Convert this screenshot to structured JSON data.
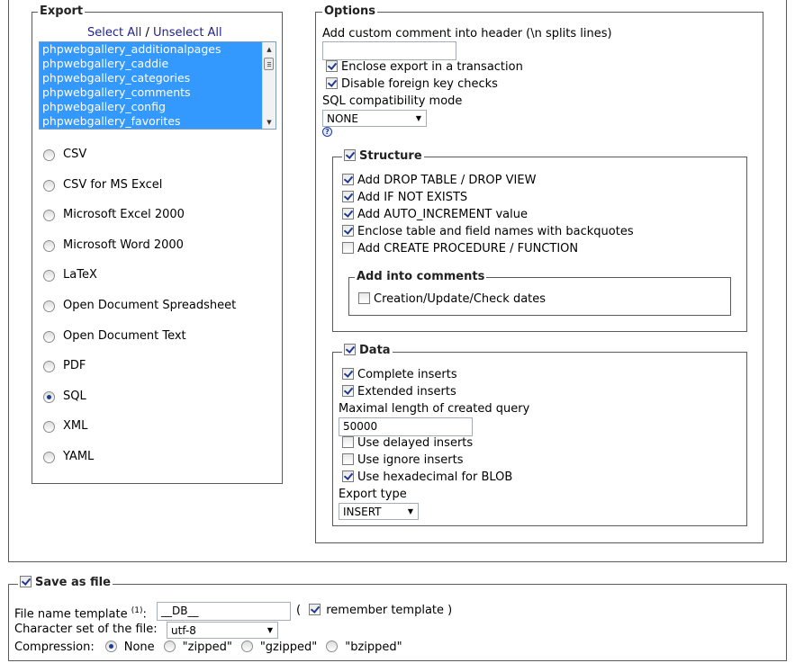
{
  "export": {
    "legend": "Export",
    "select_all": "Select All",
    "separator": "/",
    "unselect_all": "Unselect All",
    "tables": [
      "phpwebgallery_additionalpages",
      "phpwebgallery_caddie",
      "phpwebgallery_categories",
      "phpwebgallery_comments",
      "phpwebgallery_config",
      "phpwebgallery_favorites"
    ],
    "formats": [
      {
        "label": "CSV",
        "selected": false
      },
      {
        "label": "CSV for MS Excel",
        "selected": false
      },
      {
        "label": "Microsoft Excel 2000",
        "selected": false
      },
      {
        "label": "Microsoft Word 2000",
        "selected": false
      },
      {
        "label": "LaTeX",
        "selected": false
      },
      {
        "label": "Open Document Spreadsheet",
        "selected": false
      },
      {
        "label": "Open Document Text",
        "selected": false
      },
      {
        "label": "PDF",
        "selected": false
      },
      {
        "label": "SQL",
        "selected": true
      },
      {
        "label": "XML",
        "selected": false
      },
      {
        "label": "YAML",
        "selected": false
      }
    ]
  },
  "options": {
    "legend": "Options",
    "comment_label": "Add custom comment into header (\\n splits lines)",
    "comment_value": "",
    "transaction": {
      "label": "Enclose export in a transaction",
      "checked": true
    },
    "foreign_keys": {
      "label": "Disable foreign key checks",
      "checked": true
    },
    "compat_label": "SQL compatibility mode",
    "compat_value": "NONE",
    "help_glyph": "?"
  },
  "structure": {
    "legend": "Structure",
    "checked": true,
    "items": [
      {
        "label": "Add DROP TABLE / DROP VIEW",
        "checked": true
      },
      {
        "label": "Add IF NOT EXISTS",
        "checked": true
      },
      {
        "label": "Add AUTO_INCREMENT value",
        "checked": true
      },
      {
        "label": "Enclose table and field names with backquotes",
        "checked": true
      },
      {
        "label": "Add CREATE PROCEDURE / FUNCTION",
        "checked": false
      }
    ],
    "comments_legend": "Add into comments",
    "comments_dates": {
      "label": "Creation/Update/Check dates",
      "checked": false
    }
  },
  "data_section": {
    "legend": "Data",
    "checked": true,
    "complete_inserts": {
      "label": "Complete inserts",
      "checked": true
    },
    "extended_inserts": {
      "label": "Extended inserts",
      "checked": true
    },
    "max_length_label": "Maximal length of created query",
    "max_length_value": "50000",
    "delayed_inserts": {
      "label": "Use delayed inserts",
      "checked": false
    },
    "ignore_inserts": {
      "label": "Use ignore inserts",
      "checked": false
    },
    "hex_blob": {
      "label": "Use hexadecimal for BLOB",
      "checked": true
    },
    "export_type_label": "Export type",
    "export_type_value": "INSERT"
  },
  "save": {
    "legend": "Save as file",
    "checked": true,
    "filename_label": "File name template",
    "filename_sup": "(1)",
    "filename_colon": ":",
    "filename_value": "__DB__",
    "paren_open": "(",
    "remember_label": "remember template",
    "remember_checked": true,
    "paren_close": ")",
    "charset_label": "Character set of the file:",
    "charset_value": "utf-8",
    "compression_label": "Compression:",
    "compression_options": [
      {
        "label": "None",
        "selected": true
      },
      {
        "label": "\"zipped\"",
        "selected": false
      },
      {
        "label": "\"gzipped\"",
        "selected": false
      },
      {
        "label": "\"bzipped\"",
        "selected": false
      }
    ]
  }
}
